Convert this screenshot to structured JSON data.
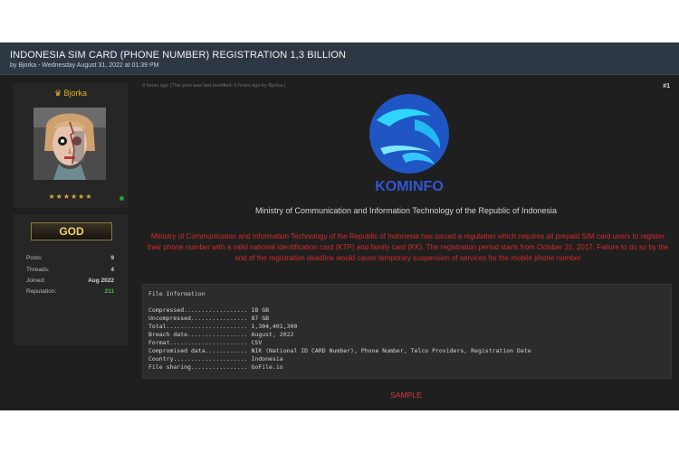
{
  "thread": {
    "title": "INDONESIA SIM CARD (PHONE NUMBER) REGISTRATION 1,3 BILLION",
    "meta": "by Bjorka - Wednesday August 31, 2022 at 01:39 PM"
  },
  "user": {
    "crown_icon": "crown-icon",
    "username": "Bjorka",
    "stars": "★★★★★★",
    "rank": "GOD",
    "stats": [
      {
        "label": "Posts:",
        "value": "9"
      },
      {
        "label": "Threads:",
        "value": "4"
      },
      {
        "label": "Joined:",
        "value": "Aug 2022"
      },
      {
        "label": "Reputation:",
        "value": "211"
      }
    ]
  },
  "post": {
    "time": "9 hours ago  (This post was last modified: 6 hours ago by Bjorka.)",
    "number": "#1",
    "logo_text": "KOMINFO",
    "ministry_caption": "Ministry of Communication and Information Technology of the Republic of Indonesia",
    "announcement": "Ministry of Communication and Information Technology of the Republic of Indonesia has issued a regulation which requires all prepaid SIM card users to register their phone number with a valid national identification card (KTP) and family card (KK). The registration period starts from October 31, 2017. Failure to do so by the end of the registration deadline would cause temporary suspension of services for the mobile phone number",
    "code_title": "File Information",
    "code_lines": [
      "Compressed.................. 18 GB",
      "Uncompressed................ 87 GB",
      "Total....................... 1,304,401,300",
      "Breach date................. August, 2022",
      "Format...................... CSV",
      "Compromised data............ NIK (National ID CARD Number), Phone Number, Telco Providers, Registration Date",
      "Country..................... Indonesia",
      "File sharing................ GoFile.io"
    ],
    "sample_label": "SAMPLE"
  },
  "colors": {
    "header_bg": "#2e3845",
    "page_bg": "#1f1f1f",
    "accent_red": "#d52a2a",
    "logo_blue": "#1f5fd0",
    "logo_cyan": "#20b8e8"
  }
}
